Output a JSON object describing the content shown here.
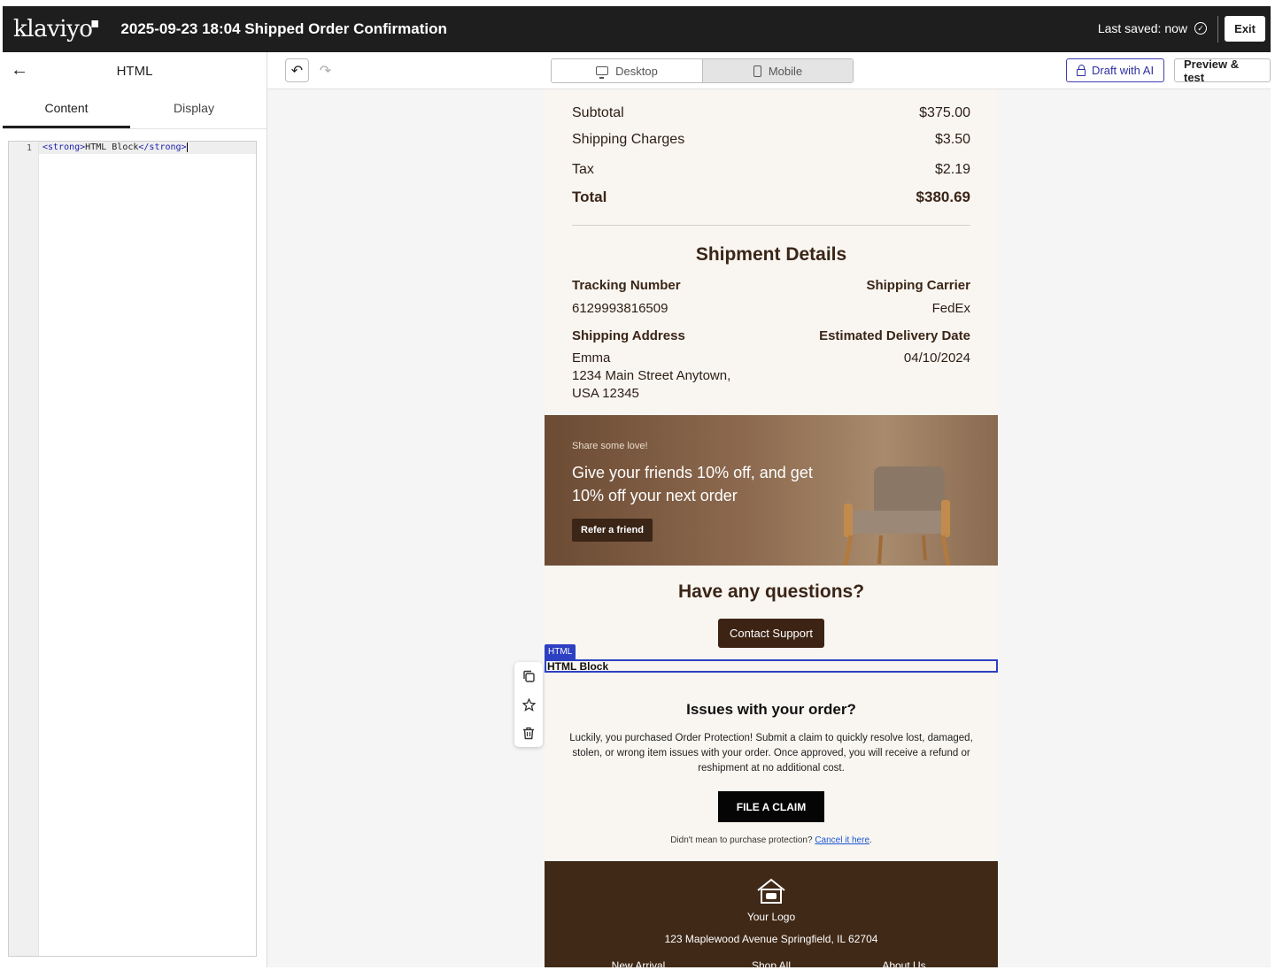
{
  "header": {
    "logo": "klaviyo",
    "doc_title": "2025-09-23 18:04 Shipped Order Confirmation",
    "saved_status": "Last saved: now",
    "exit_label": "Exit"
  },
  "left_panel": {
    "title": "HTML",
    "tabs": [
      {
        "label": "Content",
        "active": true
      },
      {
        "label": "Display",
        "active": false
      }
    ],
    "editor": {
      "line_number": "1",
      "code_open_tag": "<strong>",
      "code_text": "HTML Block",
      "code_close_tag": "</strong>"
    }
  },
  "toolbar": {
    "desktop_label": "Desktop",
    "mobile_label": "Mobile",
    "draft_ai_label": "Draft with AI",
    "preview_label": "Preview & test"
  },
  "email": {
    "summary": [
      {
        "label": "Subtotal",
        "value": "$375.00"
      },
      {
        "label": "Shipping Charges",
        "value": "$3.50"
      },
      {
        "label": "Tax",
        "value": "$2.19"
      },
      {
        "label": "Total",
        "value": "$380.69"
      }
    ],
    "shipment": {
      "title": "Shipment Details",
      "tracking_label": "Tracking Number",
      "tracking_value": "6129993816509",
      "carrier_label": "Shipping Carrier",
      "carrier_value": "FedEx",
      "address_label": "Shipping Address",
      "address_name": "Emma",
      "address_line1": "1234 Main Street Anytown,",
      "address_line2": "USA 12345",
      "delivery_label": "Estimated Delivery Date",
      "delivery_value": "04/10/2024"
    },
    "banner": {
      "kicker": "Share some love!",
      "headline": "Give your friends 10% off, and get 10% off your next order",
      "button": "Refer a friend"
    },
    "questions": {
      "title": "Have any questions?",
      "button": "Contact Support"
    },
    "html_block": {
      "badge": "HTML",
      "text": "HTML Block"
    },
    "issues": {
      "title": "Issues with your order?",
      "body": "Luckily, you purchased Order Protection! Submit a claim to quickly resolve lost, damaged, stolen, or wrong item issues with your order. Once approved, you will receive a refund or reshipment at no additional cost.",
      "button": "FILE A CLAIM",
      "cancel_prefix": "Didn't mean to purchase protection?",
      "cancel_link": "Cancel it here",
      "cancel_suffix": "."
    },
    "footer": {
      "logo_text": "Your Logo",
      "address": "123 Maplewood Avenue Springfield, IL 62704",
      "links": [
        "New Arrival",
        "Shop All",
        "About Us"
      ]
    }
  },
  "block_actions": [
    "copy-icon",
    "star-icon",
    "trash-icon"
  ],
  "colors": {
    "topbar": "#1e1e1e",
    "accent_blue": "#2d3fc2",
    "brown": "#3a2517",
    "footer_brown": "#402917",
    "cream": "#f9f6f1"
  }
}
